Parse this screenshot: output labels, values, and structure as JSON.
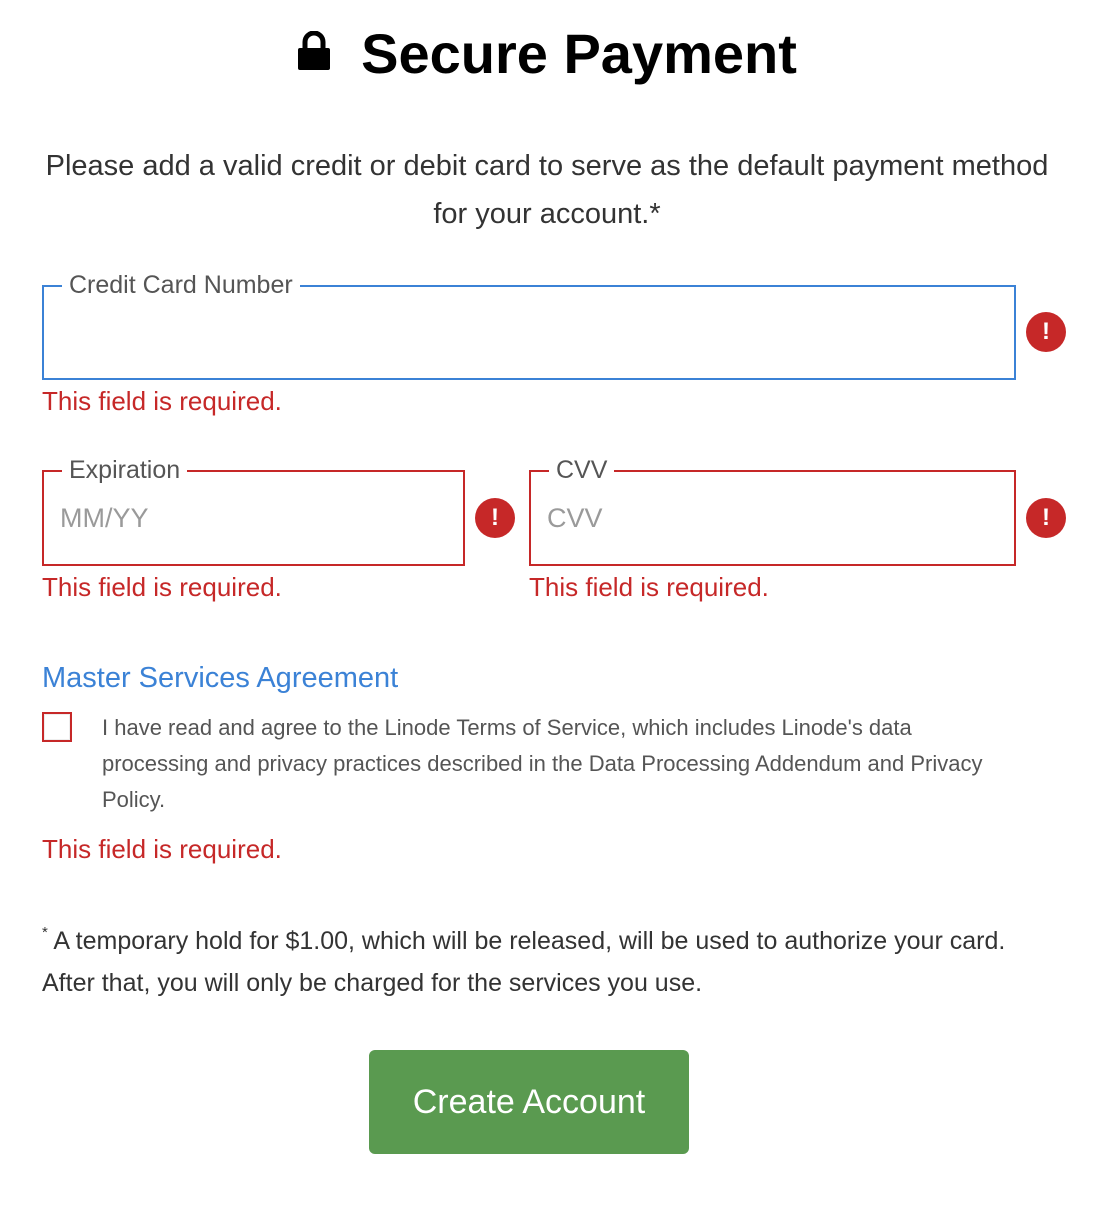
{
  "header": {
    "icon": "lock-icon",
    "title": "Secure Payment"
  },
  "intro": {
    "text": "Please add a valid credit or debit card to serve as the default payment method for your account.*"
  },
  "card_number": {
    "label": "Credit Card Number",
    "value": "",
    "placeholder": "",
    "error_icon": "exclamation-icon",
    "error": "This field is required."
  },
  "expiration": {
    "label": "Expiration",
    "value": "",
    "placeholder": "MM/YY",
    "error_icon": "exclamation-icon",
    "error": "This field is required."
  },
  "cvv": {
    "label": "CVV",
    "value": "",
    "placeholder": "CVV",
    "error_icon": "exclamation-icon",
    "error": "This field is required."
  },
  "msa": {
    "heading": "Master Services Agreement",
    "checked": false,
    "text": "I have read and agree to the Linode Terms of Service, which includes Linode's data processing and privacy practices described in the Data Processing Addendum and Privacy Policy.",
    "error": "This field is required."
  },
  "footnote": {
    "marker": "*",
    "text": " A temporary hold for $1.00, which will be released, will be used to authorize your card. After that, you will only be charged for the services you use."
  },
  "submit": {
    "label": "Create Account"
  },
  "colors": {
    "error": "#c62828",
    "focus": "#3b82d6",
    "link": "#3b82d6",
    "button": "#5a9a50"
  }
}
